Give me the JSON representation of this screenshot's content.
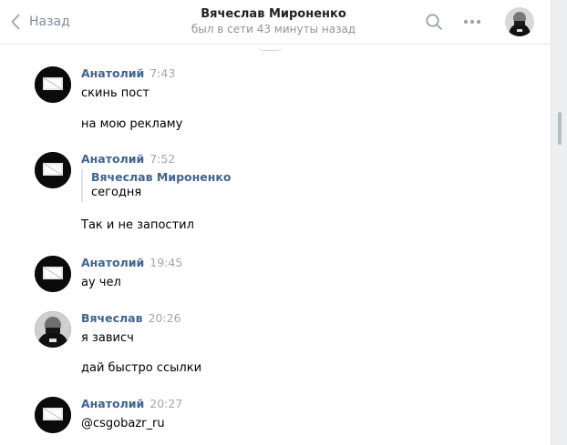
{
  "header": {
    "back_label": "Назад",
    "peer_name": "Вячеслав Мироненко",
    "peer_status": "был в сети 43 минуты назад",
    "icons": [
      "chevron-left-icon",
      "search-icon",
      "more-icon",
      "avatar"
    ]
  },
  "colors": {
    "link": "#42648b",
    "muted": "#939393",
    "divider": "#e7e8ec",
    "gutter": "#edeef0"
  },
  "messages": [
    {
      "author": "Анатолий",
      "time": "7:43",
      "lines": [
        "скинь пост",
        "на мою рекламу"
      ]
    },
    {
      "author": "Анатолий",
      "time": "7:52",
      "forward": {
        "author": "Вячеслав Мироненко",
        "text": "сегодня"
      },
      "lines": [
        "Так и не запостил"
      ]
    },
    {
      "author": "Анатолий",
      "time": "19:45",
      "lines": [
        "ау чел"
      ]
    },
    {
      "author": "Вячеслав",
      "time": "20:26",
      "lines": [
        "я зависч",
        "дай быстро ссылки"
      ]
    },
    {
      "author": "Анатолий",
      "time": "20:27",
      "lines": [
        "@csgobazr_ru"
      ]
    }
  ]
}
